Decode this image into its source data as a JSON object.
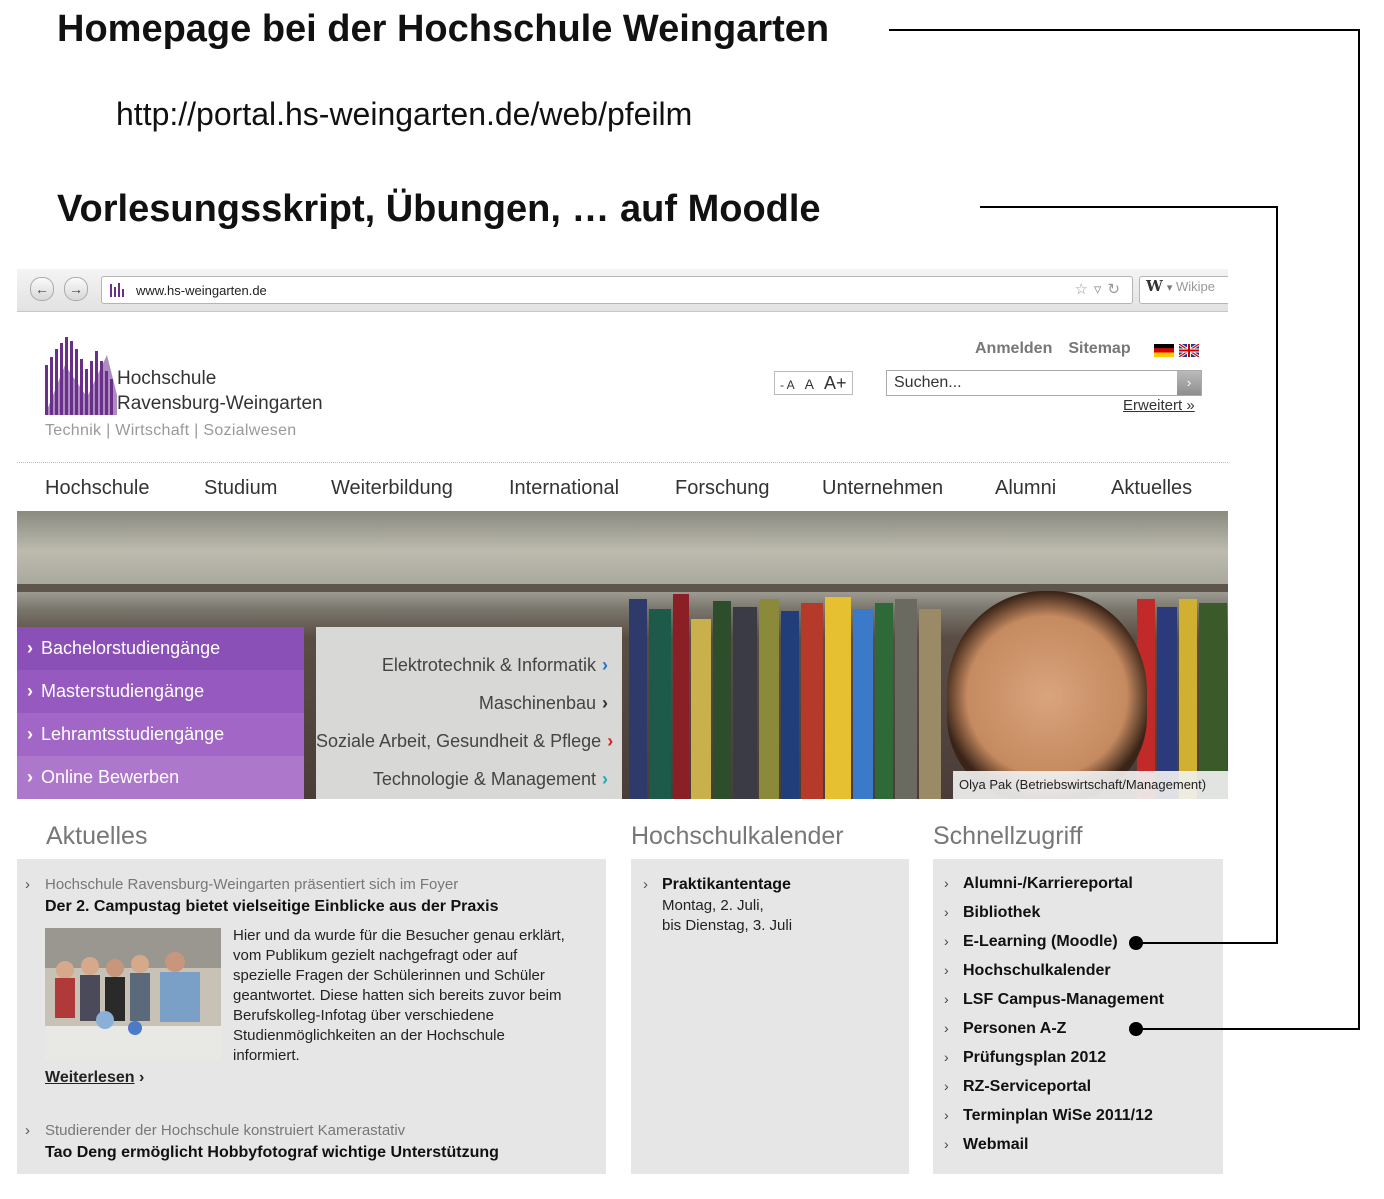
{
  "slide": {
    "heading1": "Homepage bei der Hochschule Weingarten",
    "url": "http://portal.hs-weingarten.de/web/pfeilm",
    "heading2": "Vorlesungsskript, Übungen, … auf Moodle"
  },
  "browser": {
    "address": "www.hs-weingarten.de",
    "search_engine_label": "Wikipe",
    "back_icon": "back-arrow-icon",
    "forward_icon": "forward-arrow-icon"
  },
  "site": {
    "logo": {
      "name_line1": "Hochschule",
      "name_line2": "Ravensburg-Weingarten",
      "tagline": "Technik  | Wirtschaft  |  Sozialwesen",
      "color": "#6a2f8a"
    },
    "header_links": [
      "Anmelden",
      "Sitemap"
    ],
    "font_size_controls": [
      "- A",
      "A",
      "A+"
    ],
    "search_placeholder": "Suchen...",
    "search_extended": "Erweitert »",
    "nav": [
      "Hochschule",
      "Studium",
      "Weiterbildung",
      "International",
      "Forschung",
      "Unternehmen",
      "Alumni",
      "Aktuelles"
    ],
    "hero": {
      "purple_menu": [
        "Bachelorstudiengänge",
        "Masterstudiengänge",
        "Lehramtsstudiengänge",
        "Online Bewerben"
      ],
      "gray_menu": [
        {
          "label": "Elektrotechnik & Informatik",
          "arrow": "›",
          "color": "#2a72c8"
        },
        {
          "label": "Maschinenbau",
          "arrow": "›",
          "color": "#333333"
        },
        {
          "label": "Soziale Arbeit, Gesundheit & Pflege",
          "arrow": "›",
          "color": "#d0261f"
        },
        {
          "label": "Technologie & Management",
          "arrow": "›",
          "color": "#22a9b8"
        }
      ],
      "caption": "Olya Pak (Betriebswirtschaft/Management)"
    },
    "news": {
      "title": "Aktuelles",
      "item1": {
        "kicker": "Hochschule Ravensburg-Weingarten präsentiert sich im Foyer",
        "headline": "Der 2. Campustag bietet vielseitige Einblicke aus der Praxis",
        "body": "Hier und da wurde für die Besucher genau erklärt, vom Publikum gezielt nachgefragt oder auf spezielle Fragen der Schülerinnen und Schüler geantwortet. Diese hatten sich bereits zuvor beim Berufskolleg-Infotag über verschiedene Studienmöglichkeiten an der Hochschule informiert.",
        "more": "Weiterlesen"
      },
      "item2": {
        "kicker": "Studierender der Hochschule konstruiert Kamerastativ",
        "headline": "Tao Deng ermöglicht Hobbyfotograf wichtige Unterstützung"
      }
    },
    "calendar": {
      "title": "Hochschulkalender",
      "event": "Praktikantentage",
      "line1": "Montag, 2. Juli,",
      "line2": "bis Dienstag, 3. Juli"
    },
    "quick": {
      "title": "Schnellzugriff",
      "items": [
        "Alumni-/Karriereportal",
        "Bibliothek",
        "E-Learning (Moodle)",
        "Hochschulkalender",
        "LSF Campus-Management",
        "Personen A-Z",
        "Prüfungsplan 2012",
        "RZ-Serviceportal",
        "Terminplan WiSe 2011/12",
        "Webmail"
      ]
    }
  }
}
